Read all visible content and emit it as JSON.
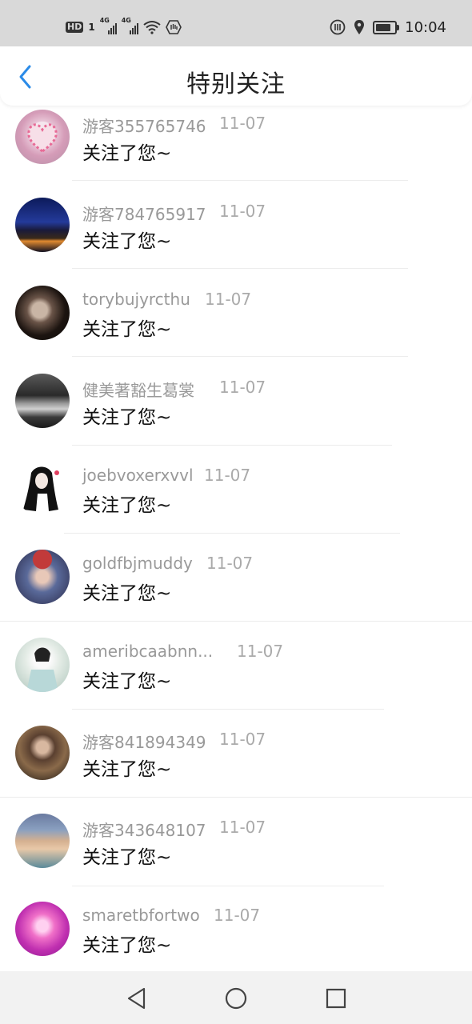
{
  "status_bar": {
    "hd_badge": "HD",
    "hd_num": "1",
    "network_1": "4G",
    "network_2": "4G",
    "time": "10:04",
    "battery_level": 0.8,
    "icons": [
      "signal-icon",
      "wifi-icon",
      "hand-icon",
      "nfc-icon",
      "location-icon",
      "battery-icon"
    ]
  },
  "header": {
    "title": "特别关注",
    "back_icon": "chevron-left-icon",
    "accent_color": "#2b8be8"
  },
  "items": [
    {
      "name": "游客355765746",
      "date": "11-07",
      "message": "关注了您~"
    },
    {
      "name": "游客784765917",
      "date": "11-07",
      "message": "关注了您~"
    },
    {
      "name": "torybujyrcthu",
      "date": "11-07",
      "message": "关注了您~"
    },
    {
      "name": "健美著豁生葛裳",
      "date": "11-07",
      "message": "关注了您~"
    },
    {
      "name": "joebvoxerxvvl",
      "date": "11-07",
      "message": "关注了您~"
    },
    {
      "name": "goldfbjmuddy",
      "date": "11-07",
      "message": "关注了您~"
    },
    {
      "name": "ameribcaabnn...",
      "date": "11-07",
      "message": "关注了您~"
    },
    {
      "name": "游客841894349",
      "date": "11-07",
      "message": "关注了您~"
    },
    {
      "name": "游客343648107",
      "date": "11-07",
      "message": "关注了您~"
    },
    {
      "name": "smaretbfortwo",
      "date": "11-07",
      "message": "关注了您~"
    }
  ],
  "nav_bar": {
    "icons": [
      "back-triangle-icon",
      "home-circle-icon",
      "recents-square-icon"
    ]
  }
}
